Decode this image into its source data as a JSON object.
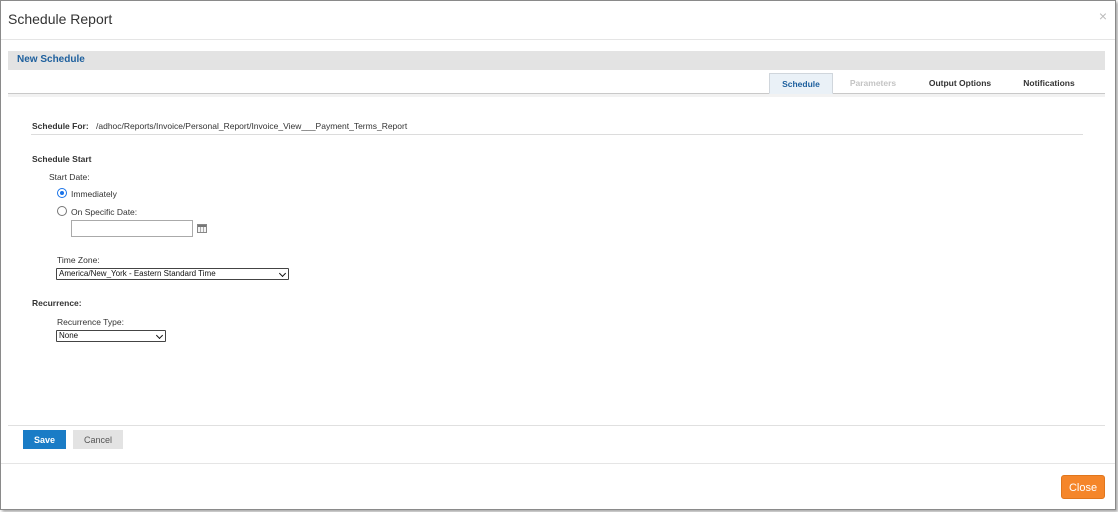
{
  "dialog": {
    "title": "Schedule Report",
    "close_glyph": "×",
    "close_button_label": "Close"
  },
  "section_title": "New Schedule",
  "tabs": [
    {
      "label": "Schedule",
      "state": "active"
    },
    {
      "label": "Parameters",
      "state": "disabled"
    },
    {
      "label": "Output Options",
      "state": "normal"
    },
    {
      "label": "Notifications",
      "state": "normal"
    }
  ],
  "schedule_for": {
    "label": "Schedule For:",
    "path": "/adhoc/Reports/Invoice/Personal_Report/Invoice_View___Payment_Terms_Report"
  },
  "schedule_start": {
    "heading": "Schedule Start",
    "start_date_label": "Start Date:",
    "options": [
      {
        "label": "Immediately",
        "checked": true
      },
      {
        "label": "On Specific Date:",
        "checked": false
      }
    ],
    "specific_date_value": "",
    "time_zone_label": "Time Zone:",
    "time_zone_value": "America/New_York - Eastern Standard Time"
  },
  "recurrence": {
    "heading": "Recurrence:",
    "type_label": "Recurrence Type:",
    "type_value": "None"
  },
  "actions": {
    "save_label": "Save",
    "cancel_label": "Cancel"
  },
  "icons": {
    "calendar": "calendar-icon",
    "dialog_close": "close-icon",
    "dropdown": "chevron-down-icon"
  },
  "colors": {
    "save_button": "#1a7cc6",
    "close_button": "#f5862a",
    "section_title": "#1d5f9d",
    "radio_selected": "#1a73e8"
  }
}
